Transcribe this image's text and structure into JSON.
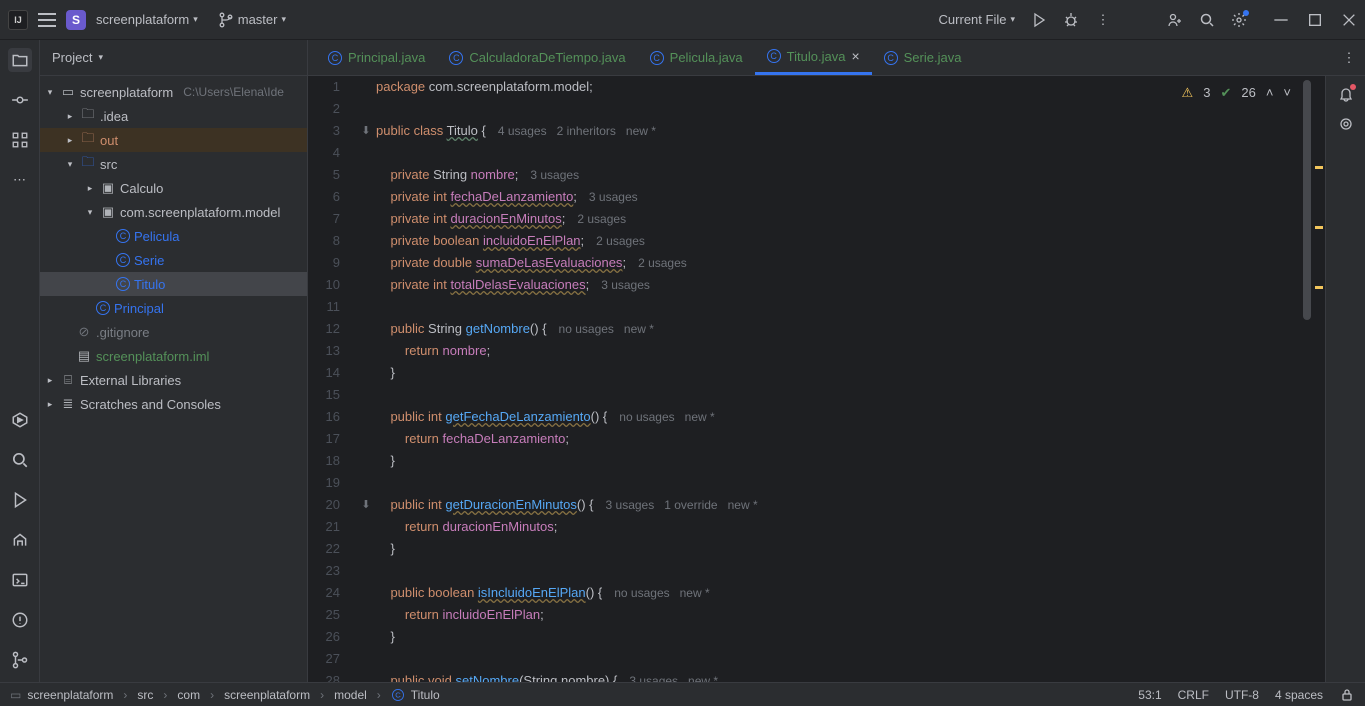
{
  "titlebar": {
    "project_initial": "S",
    "project_name": "screenplataform",
    "branch": "master",
    "run_config": "Current File"
  },
  "panel": {
    "title": "Project"
  },
  "tree": {
    "root": "screenplataform",
    "root_path": "C:\\Users\\Elena\\Ide",
    "idea": ".idea",
    "out": "out",
    "src": "src",
    "calculo": "Calculo",
    "model_pkg": "com.screenplataform.model",
    "pelicula": "Pelicula",
    "serie": "Serie",
    "titulo": "Titulo",
    "principal": "Principal",
    "gitignore": ".gitignore",
    "iml": "screenplataform.iml",
    "ext_lib": "External Libraries",
    "scratches": "Scratches and Consoles"
  },
  "tabs": [
    {
      "label": "Principal.java",
      "active": false
    },
    {
      "label": "CalculadoraDeTiempo.java",
      "active": false
    },
    {
      "label": "Pelicula.java",
      "active": false
    },
    {
      "label": "Titulo.java",
      "active": true
    },
    {
      "label": "Serie.java",
      "active": false
    }
  ],
  "inspections": {
    "warnings": "3",
    "checks": "26"
  },
  "code": {
    "l1_pkg": "package ",
    "l1_val": "com.screenplataform.model",
    "l3_a": "public class ",
    "l3_cls": "Titulo",
    "l3_b": " {",
    "l3_h": "4 usages   2 inheritors   new *",
    "l5_a": "private ",
    "l5_t": "String ",
    "l5_f": "nombre",
    "l5_s": ";",
    "l5_h": "3 usages",
    "l6_a": "private int ",
    "l6_f": "fechaDeLanzamiento",
    "l6_s": ";",
    "l6_h": "3 usages",
    "l7_a": "private int ",
    "l7_f": "duracionEnMinutos",
    "l7_s": ";",
    "l7_h": "2 usages",
    "l8_a": "private boolean ",
    "l8_f": "incluidoEnElPlan",
    "l8_s": ";",
    "l8_h": "2 usages",
    "l9_a": "private double ",
    "l9_f": "sumaDeLasEvaluaciones",
    "l9_s": ";",
    "l9_h": "2 usages",
    "l10_a": "private int ",
    "l10_f": "totalDelasEvaluaciones",
    "l10_s": ";",
    "l10_h": "3 usages",
    "l12_a": "public ",
    "l12_t": "String ",
    "l12_m": "getNombre",
    "l12_b": "() {",
    "l12_h": "no usages   new *",
    "l13_a": "return ",
    "l13_f": "nombre",
    "l13_s": ";",
    "l14": "}",
    "l16_a": "public int ",
    "l16_m": "getFechaDeLanzamiento",
    "l16_b": "() {",
    "l16_h": "no usages   new *",
    "l17_a": "return ",
    "l17_f": "fechaDeLanzamiento",
    "l17_s": ";",
    "l18": "}",
    "l20_a": "public int ",
    "l20_m": "getDuracionEnMinutos",
    "l20_b": "() {",
    "l20_h": "3 usages   1 override   new *",
    "l21_a": "return ",
    "l21_f": "duracionEnMinutos",
    "l21_s": ";",
    "l22": "}",
    "l24_a": "public boolean ",
    "l24_m": "isIncluidoEnElPlan",
    "l24_b": "() {",
    "l24_h": "no usages   new *",
    "l25_a": "return ",
    "l25_f": "incluidoEnElPlan",
    "l25_s": ";",
    "l26": "}",
    "l28_a": "public void ",
    "l28_m": "setNombre",
    "l28_b": "(String nombre) {",
    "l28_h": "3 usages   new *"
  },
  "breadcrumb": [
    "screenplataform",
    "src",
    "com",
    "screenplataform",
    "model",
    "Titulo"
  ],
  "status": {
    "pos": "53:1",
    "eol": "CRLF",
    "enc": "UTF-8",
    "indent": "4 spaces"
  }
}
